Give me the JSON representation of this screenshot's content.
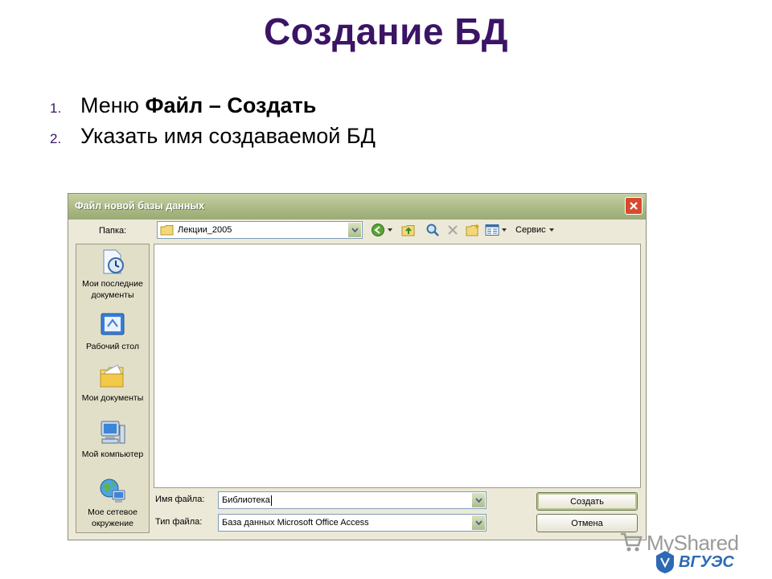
{
  "slide": {
    "title": "Создание БД",
    "steps": [
      {
        "num": "1.",
        "text": "Меню ",
        "bold": "Файл – Создать"
      },
      {
        "num": "2.",
        "text": "Указать имя создаваемой БД"
      }
    ]
  },
  "dialog": {
    "title": "Файл новой базы данных",
    "folder_label": "Папка:",
    "folder_value": "Лекции_2005",
    "tools_label": "Сервис",
    "places": [
      {
        "label": "Мои последние документы",
        "icon": "recent-documents-icon"
      },
      {
        "label": "Рабочий стол",
        "icon": "desktop-icon"
      },
      {
        "label": "Мои документы",
        "icon": "my-documents-icon"
      },
      {
        "label": "Мой компьютер",
        "icon": "my-computer-icon"
      },
      {
        "label": "Мое сетевое окружение",
        "icon": "network-places-icon"
      }
    ],
    "filename_label": "Имя файла:",
    "filename_value": "Библиотека",
    "filetype_label": "Тип файла:",
    "filetype_value": "База данных Microsoft Office Access",
    "create_button": "Создать",
    "cancel_button": "Отмена"
  },
  "watermark": {
    "text": "MyShared",
    "logo": "ВГУЭС"
  },
  "colors": {
    "title": "#3b1466",
    "dialog_bg": "#ece9d8",
    "titlebar": "#aab884",
    "close": "#d84a2e"
  }
}
